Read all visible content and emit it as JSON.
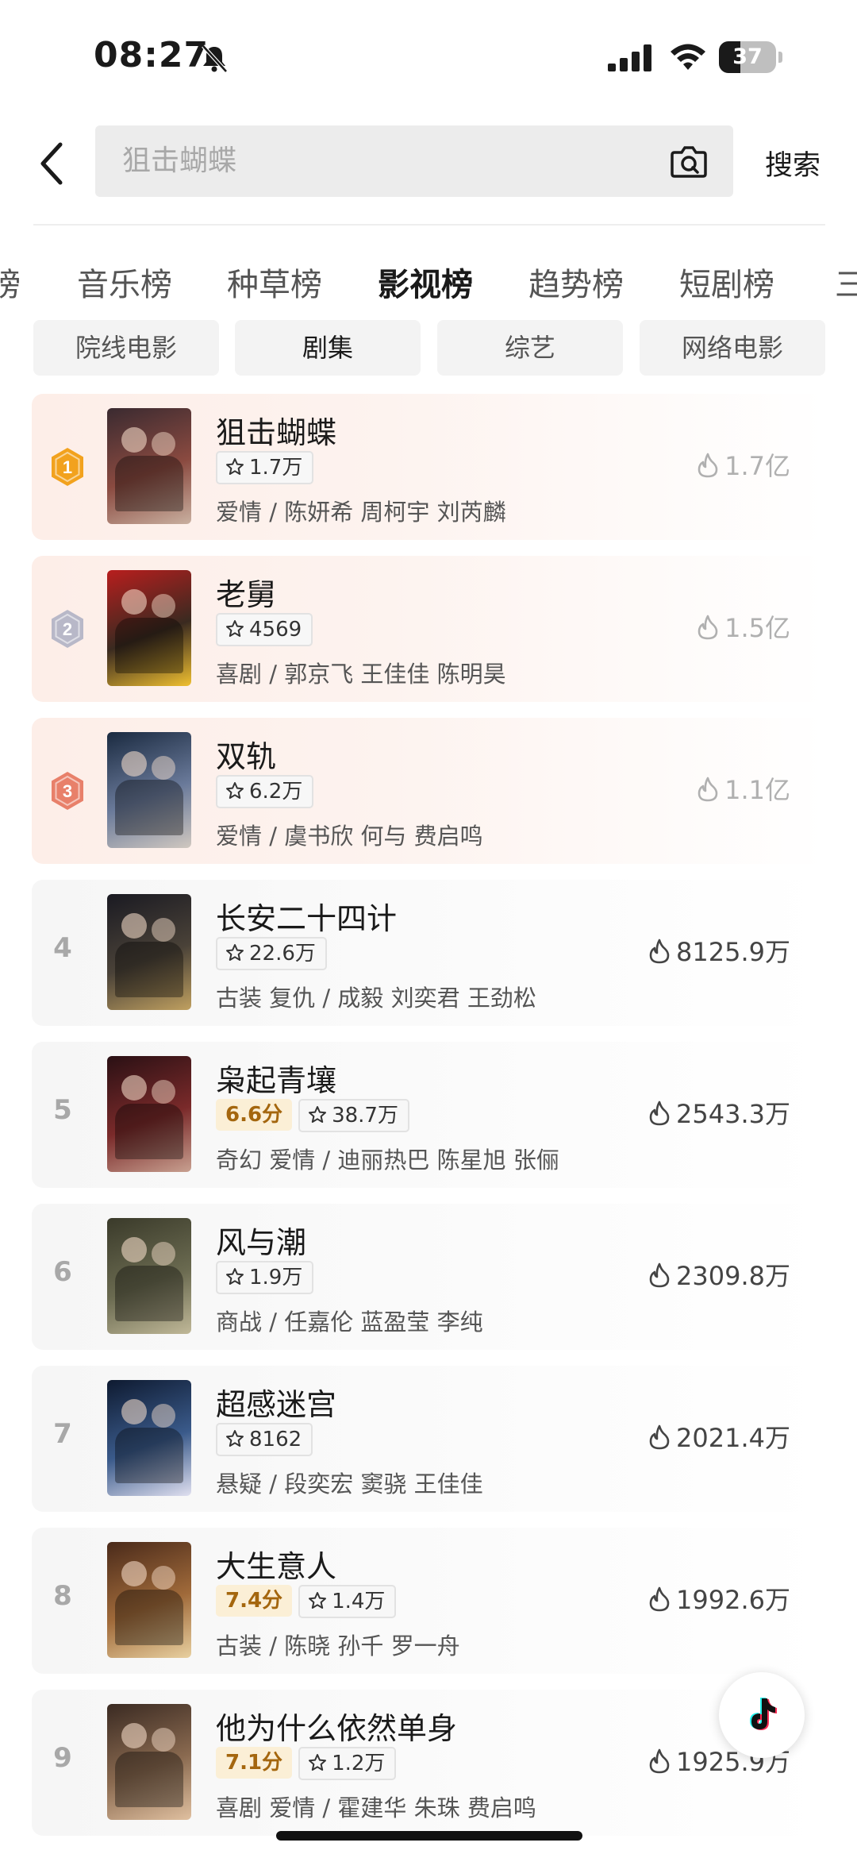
{
  "status_bar": {
    "time": "08:27",
    "battery": "37",
    "battery_fraction": 0.37
  },
  "search": {
    "placeholder": "狙击蝴蝶",
    "button_label": "搜索"
  },
  "tabs": [
    {
      "label": "榜"
    },
    {
      "label": "音乐榜"
    },
    {
      "label": "种草榜"
    },
    {
      "label": "影视榜",
      "active": true
    },
    {
      "label": "趋势榜"
    },
    {
      "label": "短剧榜"
    },
    {
      "label": "三亿"
    }
  ],
  "chips": [
    {
      "label": "院线电影"
    },
    {
      "label": "剧集",
      "active": true
    },
    {
      "label": "综艺"
    },
    {
      "label": "网络电影"
    }
  ],
  "items": [
    {
      "rank": "1",
      "title": "狙击蝴蝶",
      "score": "",
      "favorites": "1.7万",
      "meta": "爱情 / 陈妍希 周柯宇 刘芮麟",
      "heat": "1.7亿"
    },
    {
      "rank": "2",
      "title": "老舅",
      "score": "",
      "favorites": "4569",
      "meta": "喜剧 / 郭京飞 王佳佳 陈明昊",
      "heat": "1.5亿"
    },
    {
      "rank": "3",
      "title": "双轨",
      "score": "",
      "favorites": "6.2万",
      "meta": "爱情 / 虞书欣 何与 费启鸣",
      "heat": "1.1亿"
    },
    {
      "rank": "4",
      "title": "长安二十四计",
      "score": "",
      "favorites": "22.6万",
      "meta": "古装 复仇 / 成毅 刘奕君 王劲松",
      "heat": "8125.9万"
    },
    {
      "rank": "5",
      "title": "枭起青壤",
      "score": "6.6分",
      "favorites": "38.7万",
      "meta": "奇幻 爱情 / 迪丽热巴 陈星旭 张俪",
      "heat": "2543.3万"
    },
    {
      "rank": "6",
      "title": "风与潮",
      "score": "",
      "favorites": "1.9万",
      "meta": "商战 / 任嘉伦 蓝盈莹 李纯",
      "heat": "2309.8万"
    },
    {
      "rank": "7",
      "title": "超感迷宫",
      "score": "",
      "favorites": "8162",
      "meta": "悬疑 / 段奕宏 窦骁 王佳佳",
      "heat": "2021.4万"
    },
    {
      "rank": "8",
      "title": "大生意人",
      "score": "7.4分",
      "favorites": "1.4万",
      "meta": "古装 / 陈晓 孙千 罗一舟",
      "heat": "1992.6万"
    },
    {
      "rank": "9",
      "title": "他为什么依然单身",
      "score": "7.1分",
      "favorites": "1.2万",
      "meta": "喜剧 爱情 / 霍建华 朱珠 费启鸣",
      "heat": "1925.9万"
    }
  ],
  "colors": {
    "gold": "#f2a21e",
    "silver": "#b8b8c8",
    "bronze": "#e8806a",
    "heat_top": "#b0b0b0",
    "heat_other": "#444444"
  }
}
